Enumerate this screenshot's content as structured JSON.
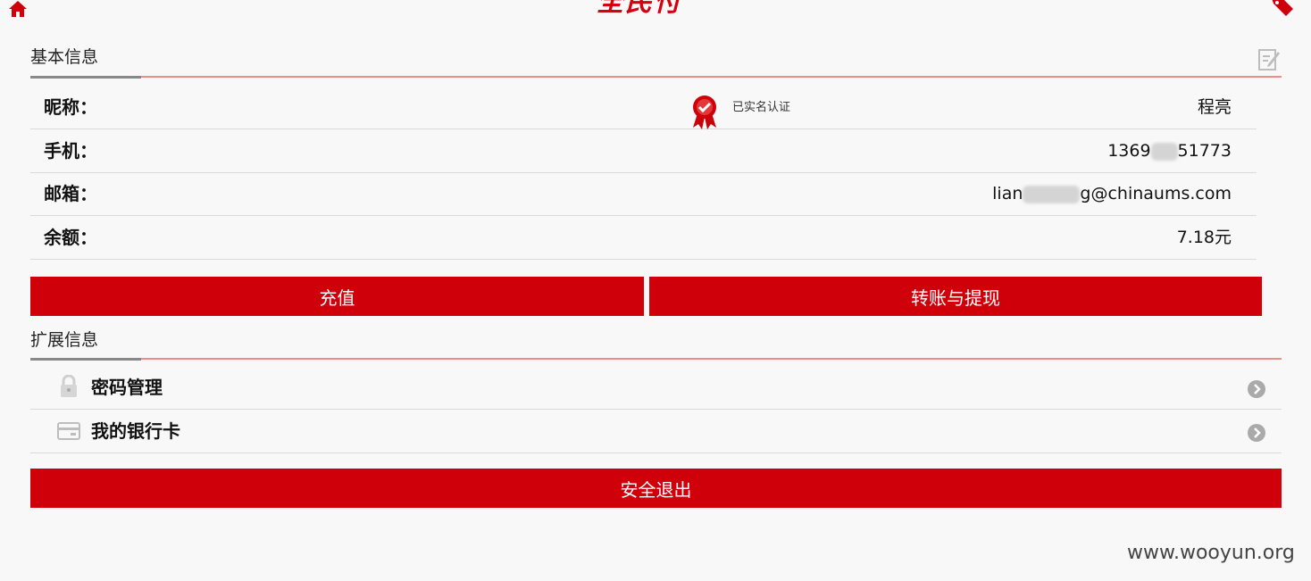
{
  "header": {
    "logo_text": "全民付",
    "home_icon": "home-icon",
    "tag_icon": "tag-icon"
  },
  "basic_info": {
    "title": "基本信息",
    "edit_icon": "edit-icon",
    "verified_text": "已实名认证",
    "rows": [
      {
        "label": "昵称：",
        "value": "程亮"
      },
      {
        "label": "手机：",
        "value_start": "1369",
        "value_end": "51773"
      },
      {
        "label": "邮箱：",
        "value_start": "lian",
        "value_mid": "g",
        "value_end": "@chinaums.com"
      },
      {
        "label": "余额：",
        "value": "7.18元"
      }
    ]
  },
  "actions": {
    "recharge_label": "充值",
    "transfer_label": "转账与提现"
  },
  "extended_info": {
    "title": "扩展信息",
    "items": [
      {
        "label": "密码管理",
        "icon": "lock-icon"
      },
      {
        "label": "我的银行卡",
        "icon": "bank-card-icon"
      }
    ]
  },
  "logout_label": "安全退出",
  "watermark": "www.wooyun.org",
  "colors": {
    "primary_red": "#d0000b",
    "divider_red": "#f08b8b",
    "background": "#f8f8f8"
  }
}
